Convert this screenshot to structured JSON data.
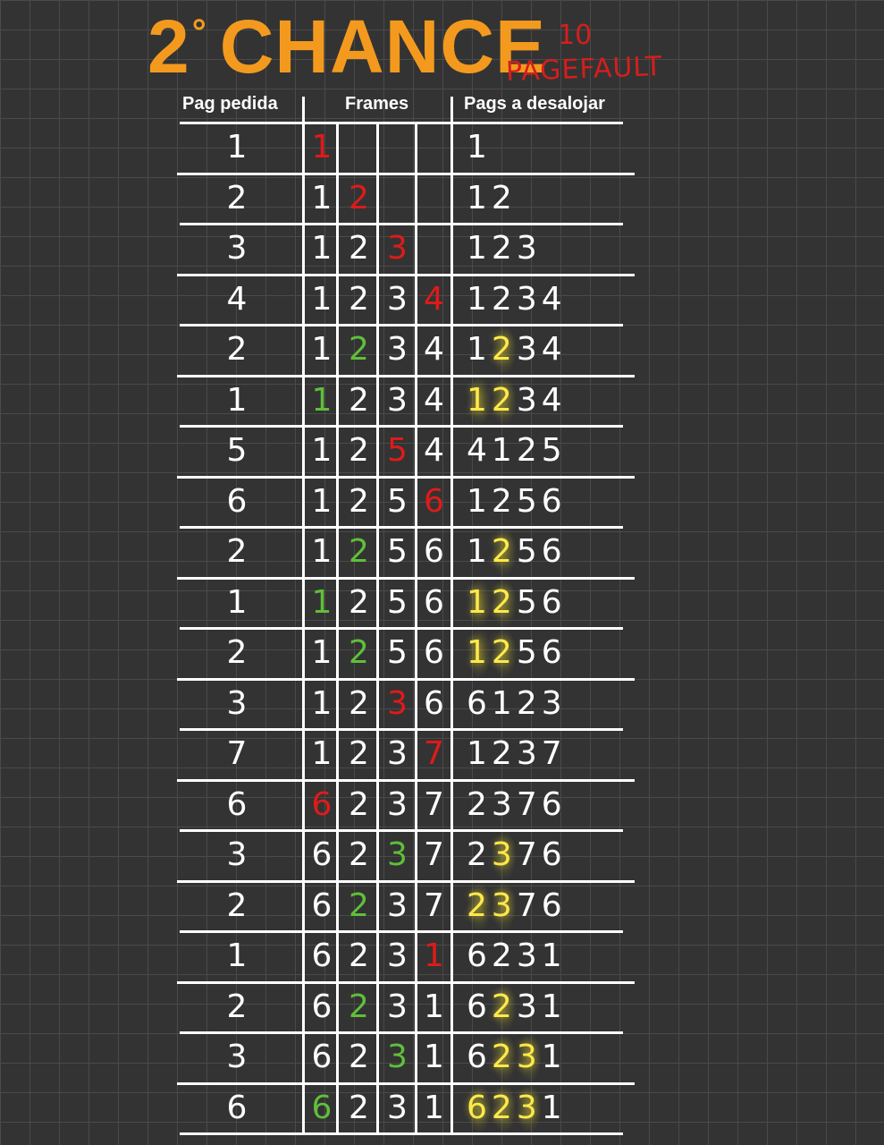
{
  "title": {
    "prefix": "2",
    "degree": "°",
    "main": "CHANCE"
  },
  "pagefault": {
    "count": "10",
    "label": "PAGEFAULT"
  },
  "headers": {
    "requested": "Pag pedida",
    "frames": "Frames",
    "evict": "Pags a desalojar"
  },
  "colors": {
    "background": "#333333",
    "title": "#f39a1e",
    "fault": "#e01a1a",
    "hit": "#5fbf3a",
    "second_chance": "#ffe94a"
  },
  "rows": [
    {
      "page": "1",
      "frames": [
        {
          "v": "1",
          "s": "fault"
        },
        {
          "v": "",
          "s": ""
        },
        {
          "v": "",
          "s": ""
        },
        {
          "v": "",
          "s": ""
        }
      ],
      "queue": [
        {
          "v": "1",
          "h": false
        }
      ]
    },
    {
      "page": "2",
      "frames": [
        {
          "v": "1",
          "s": ""
        },
        {
          "v": "2",
          "s": "fault"
        },
        {
          "v": "",
          "s": ""
        },
        {
          "v": "",
          "s": ""
        }
      ],
      "queue": [
        {
          "v": "1",
          "h": false
        },
        {
          "v": "2",
          "h": false
        }
      ]
    },
    {
      "page": "3",
      "frames": [
        {
          "v": "1",
          "s": ""
        },
        {
          "v": "2",
          "s": ""
        },
        {
          "v": "3",
          "s": "fault"
        },
        {
          "v": "",
          "s": ""
        }
      ],
      "queue": [
        {
          "v": "1",
          "h": false
        },
        {
          "v": "2",
          "h": false
        },
        {
          "v": "3",
          "h": false
        }
      ]
    },
    {
      "page": "4",
      "frames": [
        {
          "v": "1",
          "s": ""
        },
        {
          "v": "2",
          "s": ""
        },
        {
          "v": "3",
          "s": ""
        },
        {
          "v": "4",
          "s": "fault"
        }
      ],
      "queue": [
        {
          "v": "1",
          "h": false
        },
        {
          "v": "2",
          "h": false
        },
        {
          "v": "3",
          "h": false
        },
        {
          "v": "4",
          "h": false
        }
      ]
    },
    {
      "page": "2",
      "frames": [
        {
          "v": "1",
          "s": ""
        },
        {
          "v": "2",
          "s": "hit"
        },
        {
          "v": "3",
          "s": ""
        },
        {
          "v": "4",
          "s": ""
        }
      ],
      "queue": [
        {
          "v": "1",
          "h": false
        },
        {
          "v": "2",
          "h": true
        },
        {
          "v": "3",
          "h": false
        },
        {
          "v": "4",
          "h": false
        }
      ]
    },
    {
      "page": "1",
      "frames": [
        {
          "v": "1",
          "s": "hit"
        },
        {
          "v": "2",
          "s": ""
        },
        {
          "v": "3",
          "s": ""
        },
        {
          "v": "4",
          "s": ""
        }
      ],
      "queue": [
        {
          "v": "1",
          "h": true
        },
        {
          "v": "2",
          "h": true
        },
        {
          "v": "3",
          "h": false
        },
        {
          "v": "4",
          "h": false
        }
      ]
    },
    {
      "page": "5",
      "frames": [
        {
          "v": "1",
          "s": ""
        },
        {
          "v": "2",
          "s": ""
        },
        {
          "v": "5",
          "s": "fault"
        },
        {
          "v": "4",
          "s": ""
        }
      ],
      "queue": [
        {
          "v": "4",
          "h": false
        },
        {
          "v": "1",
          "h": false
        },
        {
          "v": "2",
          "h": false
        },
        {
          "v": "5",
          "h": false
        }
      ]
    },
    {
      "page": "6",
      "frames": [
        {
          "v": "1",
          "s": ""
        },
        {
          "v": "2",
          "s": ""
        },
        {
          "v": "5",
          "s": ""
        },
        {
          "v": "6",
          "s": "fault"
        }
      ],
      "queue": [
        {
          "v": "1",
          "h": false
        },
        {
          "v": "2",
          "h": false
        },
        {
          "v": "5",
          "h": false
        },
        {
          "v": "6",
          "h": false
        }
      ]
    },
    {
      "page": "2",
      "frames": [
        {
          "v": "1",
          "s": ""
        },
        {
          "v": "2",
          "s": "hit"
        },
        {
          "v": "5",
          "s": ""
        },
        {
          "v": "6",
          "s": ""
        }
      ],
      "queue": [
        {
          "v": "1",
          "h": false
        },
        {
          "v": "2",
          "h": true
        },
        {
          "v": "5",
          "h": false
        },
        {
          "v": "6",
          "h": false
        }
      ]
    },
    {
      "page": "1",
      "frames": [
        {
          "v": "1",
          "s": "hit"
        },
        {
          "v": "2",
          "s": ""
        },
        {
          "v": "5",
          "s": ""
        },
        {
          "v": "6",
          "s": ""
        }
      ],
      "queue": [
        {
          "v": "1",
          "h": true
        },
        {
          "v": "2",
          "h": true
        },
        {
          "v": "5",
          "h": false
        },
        {
          "v": "6",
          "h": false
        }
      ]
    },
    {
      "page": "2",
      "frames": [
        {
          "v": "1",
          "s": ""
        },
        {
          "v": "2",
          "s": "hit"
        },
        {
          "v": "5",
          "s": ""
        },
        {
          "v": "6",
          "s": ""
        }
      ],
      "queue": [
        {
          "v": "1",
          "h": true
        },
        {
          "v": "2",
          "h": true
        },
        {
          "v": "5",
          "h": false
        },
        {
          "v": "6",
          "h": false
        }
      ]
    },
    {
      "page": "3",
      "frames": [
        {
          "v": "1",
          "s": ""
        },
        {
          "v": "2",
          "s": ""
        },
        {
          "v": "3",
          "s": "fault"
        },
        {
          "v": "6",
          "s": ""
        }
      ],
      "queue": [
        {
          "v": "6",
          "h": false
        },
        {
          "v": "1",
          "h": false
        },
        {
          "v": "2",
          "h": false
        },
        {
          "v": "3",
          "h": false
        }
      ]
    },
    {
      "page": "7",
      "frames": [
        {
          "v": "1",
          "s": ""
        },
        {
          "v": "2",
          "s": ""
        },
        {
          "v": "3",
          "s": ""
        },
        {
          "v": "7",
          "s": "fault"
        }
      ],
      "queue": [
        {
          "v": "1",
          "h": false
        },
        {
          "v": "2",
          "h": false
        },
        {
          "v": "3",
          "h": false
        },
        {
          "v": "7",
          "h": false
        }
      ]
    },
    {
      "page": "6",
      "frames": [
        {
          "v": "6",
          "s": "fault"
        },
        {
          "v": "2",
          "s": ""
        },
        {
          "v": "3",
          "s": ""
        },
        {
          "v": "7",
          "s": ""
        }
      ],
      "queue": [
        {
          "v": "2",
          "h": false
        },
        {
          "v": "3",
          "h": false
        },
        {
          "v": "7",
          "h": false
        },
        {
          "v": "6",
          "h": false
        }
      ]
    },
    {
      "page": "3",
      "frames": [
        {
          "v": "6",
          "s": ""
        },
        {
          "v": "2",
          "s": ""
        },
        {
          "v": "3",
          "s": "hit"
        },
        {
          "v": "7",
          "s": ""
        }
      ],
      "queue": [
        {
          "v": "2",
          "h": false
        },
        {
          "v": "3",
          "h": true
        },
        {
          "v": "7",
          "h": false
        },
        {
          "v": "6",
          "h": false
        }
      ]
    },
    {
      "page": "2",
      "frames": [
        {
          "v": "6",
          "s": ""
        },
        {
          "v": "2",
          "s": "hit"
        },
        {
          "v": "3",
          "s": ""
        },
        {
          "v": "7",
          "s": ""
        }
      ],
      "queue": [
        {
          "v": "2",
          "h": true
        },
        {
          "v": "3",
          "h": true
        },
        {
          "v": "7",
          "h": false
        },
        {
          "v": "6",
          "h": false
        }
      ]
    },
    {
      "page": "1",
      "frames": [
        {
          "v": "6",
          "s": ""
        },
        {
          "v": "2",
          "s": ""
        },
        {
          "v": "3",
          "s": ""
        },
        {
          "v": "1",
          "s": "fault"
        }
      ],
      "queue": [
        {
          "v": "6",
          "h": false
        },
        {
          "v": "2",
          "h": false
        },
        {
          "v": "3",
          "h": false
        },
        {
          "v": "1",
          "h": false
        }
      ]
    },
    {
      "page": "2",
      "frames": [
        {
          "v": "6",
          "s": ""
        },
        {
          "v": "2",
          "s": "hit"
        },
        {
          "v": "3",
          "s": ""
        },
        {
          "v": "1",
          "s": ""
        }
      ],
      "queue": [
        {
          "v": "6",
          "h": false
        },
        {
          "v": "2",
          "h": true
        },
        {
          "v": "3",
          "h": false
        },
        {
          "v": "1",
          "h": false
        }
      ]
    },
    {
      "page": "3",
      "frames": [
        {
          "v": "6",
          "s": ""
        },
        {
          "v": "2",
          "s": ""
        },
        {
          "v": "3",
          "s": "hit"
        },
        {
          "v": "1",
          "s": ""
        }
      ],
      "queue": [
        {
          "v": "6",
          "h": false
        },
        {
          "v": "2",
          "h": true
        },
        {
          "v": "3",
          "h": true
        },
        {
          "v": "1",
          "h": false
        }
      ]
    },
    {
      "page": "6",
      "frames": [
        {
          "v": "6",
          "s": "hit"
        },
        {
          "v": "2",
          "s": ""
        },
        {
          "v": "3",
          "s": ""
        },
        {
          "v": "1",
          "s": ""
        }
      ],
      "queue": [
        {
          "v": "6",
          "h": true
        },
        {
          "v": "2",
          "h": true
        },
        {
          "v": "3",
          "h": true
        },
        {
          "v": "1",
          "h": false
        }
      ]
    }
  ]
}
